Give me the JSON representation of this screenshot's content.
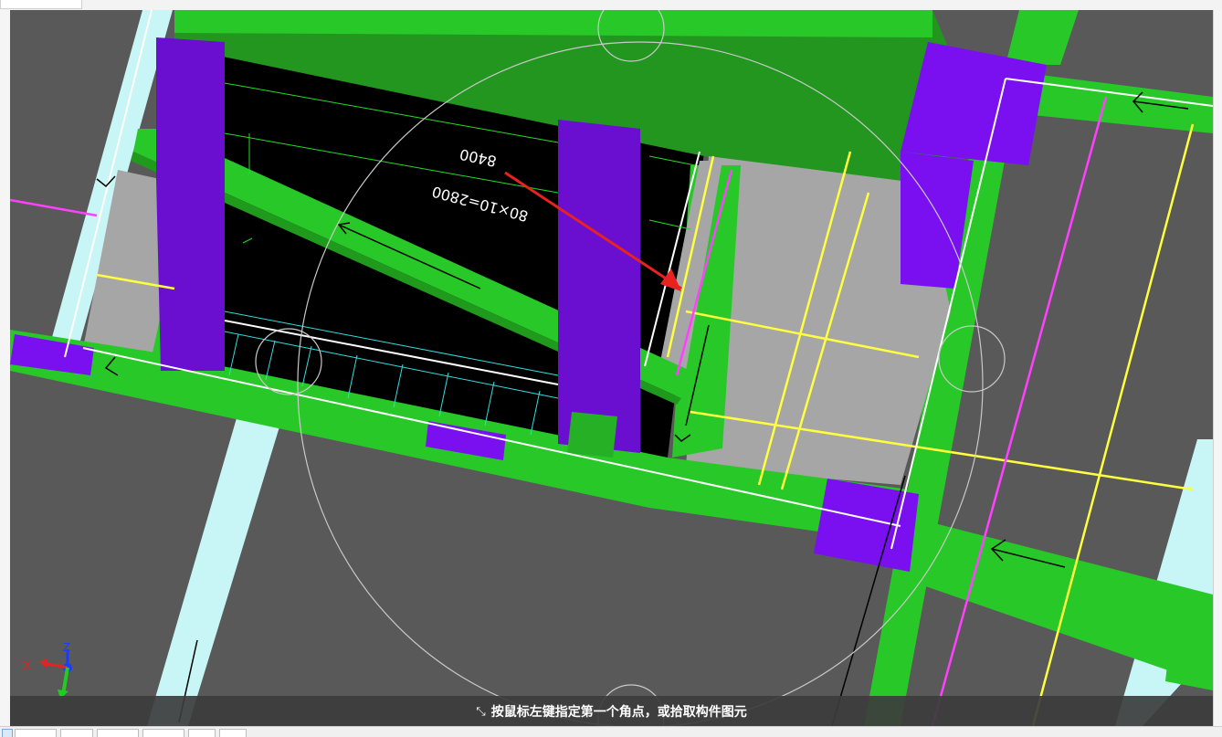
{
  "window": {
    "status_prompt": "按鼠标左键指定第一个角点，或拾取构件图元",
    "status_icon": "crosshair-corner-icon"
  },
  "drawing": {
    "dimension_main": "8400",
    "dimension_sub": "80×10=2800"
  },
  "axis_gizmo": {
    "x_label": "X",
    "z_label": "Z"
  },
  "colors": {
    "beam_green": "#28c828",
    "column_purple": "#7a10f0",
    "slab_gray": "#a6a6a6",
    "background_gray": "#595959",
    "annotation_red": "#e8231f",
    "rebar_yellow": "#ffff40",
    "rebar_magenta": "#ff40ff",
    "wall_cyan": "#c8f5f5"
  }
}
